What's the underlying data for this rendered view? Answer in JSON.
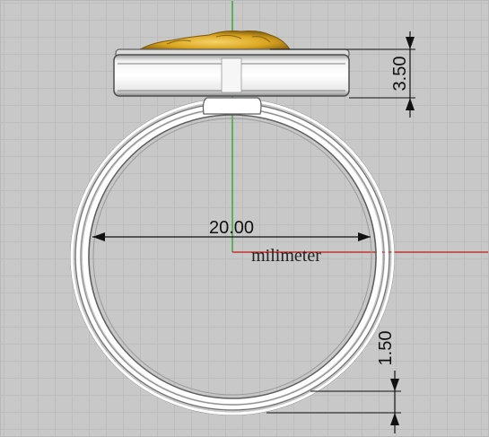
{
  "viewport": {
    "unit_label": "milimeter",
    "axis_colors": {
      "x_axis": "#c01818",
      "y_axis": "#18a018"
    }
  },
  "dimensions": {
    "ring_diameter": "20.00",
    "setting_height": "3.50",
    "band_thickness": "1.50"
  },
  "model": {
    "band_color": "#ffffff",
    "edge_color": "#606060",
    "gem_color": "#d8a020"
  }
}
